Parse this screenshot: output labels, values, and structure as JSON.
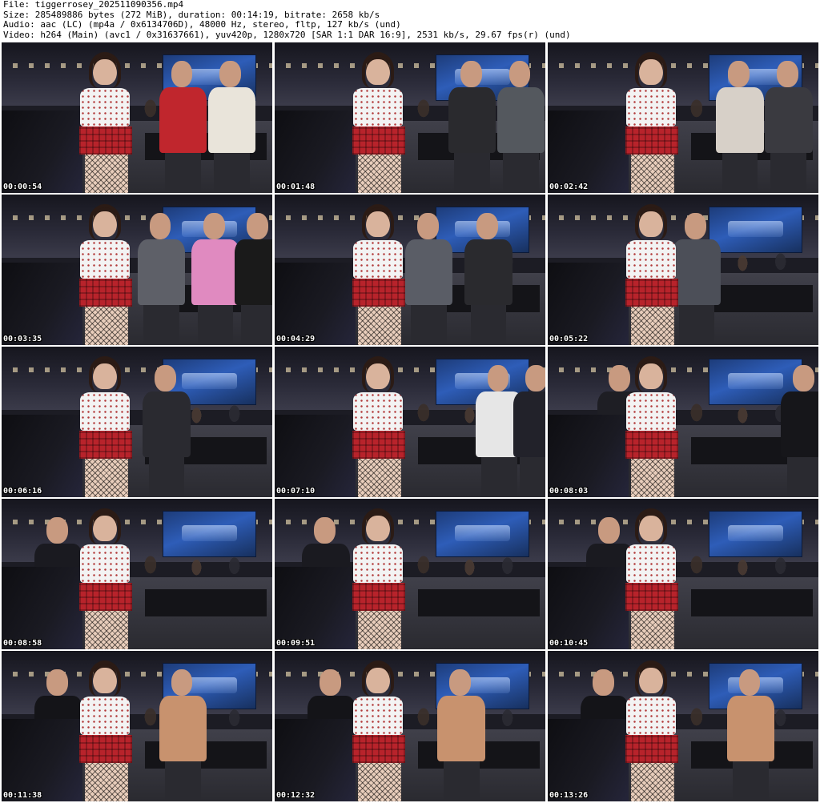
{
  "header": {
    "file_line": "File: tiggerrosey_202511090356.mp4",
    "size_line": "Size: 285489886 bytes (272 MiB), duration: 00:14:19, bitrate: 2658 kb/s",
    "audio_line": "Audio: aac (LC) (mp4a / 0x6134706D), 48000 Hz, stereo, fltp, 127 kb/s (und)",
    "video_line": "Video: h264 (Main) (avc1 / 0x31637661), yuv420p, 1280x720 [SAR 1:1 DAR 16:9], 2531 kb/s, 29.67 fps(r) (und)"
  },
  "thumbnails": [
    {
      "timestamp": "00:00:54"
    },
    {
      "timestamp": "00:01:48"
    },
    {
      "timestamp": "00:02:42"
    },
    {
      "timestamp": "00:03:35"
    },
    {
      "timestamp": "00:04:29"
    },
    {
      "timestamp": "00:05:22"
    },
    {
      "timestamp": "00:06:16"
    },
    {
      "timestamp": "00:07:10"
    },
    {
      "timestamp": "00:08:03"
    },
    {
      "timestamp": "00:08:58"
    },
    {
      "timestamp": "00:09:51"
    },
    {
      "timestamp": "00:10:45"
    },
    {
      "timestamp": "00:11:38"
    },
    {
      "timestamp": "00:12:32"
    },
    {
      "timestamp": "00:13:26"
    }
  ],
  "colors": {
    "page_background": "#ffffff",
    "header_text": "#000000",
    "timestamp_text": "#ffffff",
    "skirt_plaid": "#b8232b",
    "banner_blue": "#2e5db8"
  }
}
